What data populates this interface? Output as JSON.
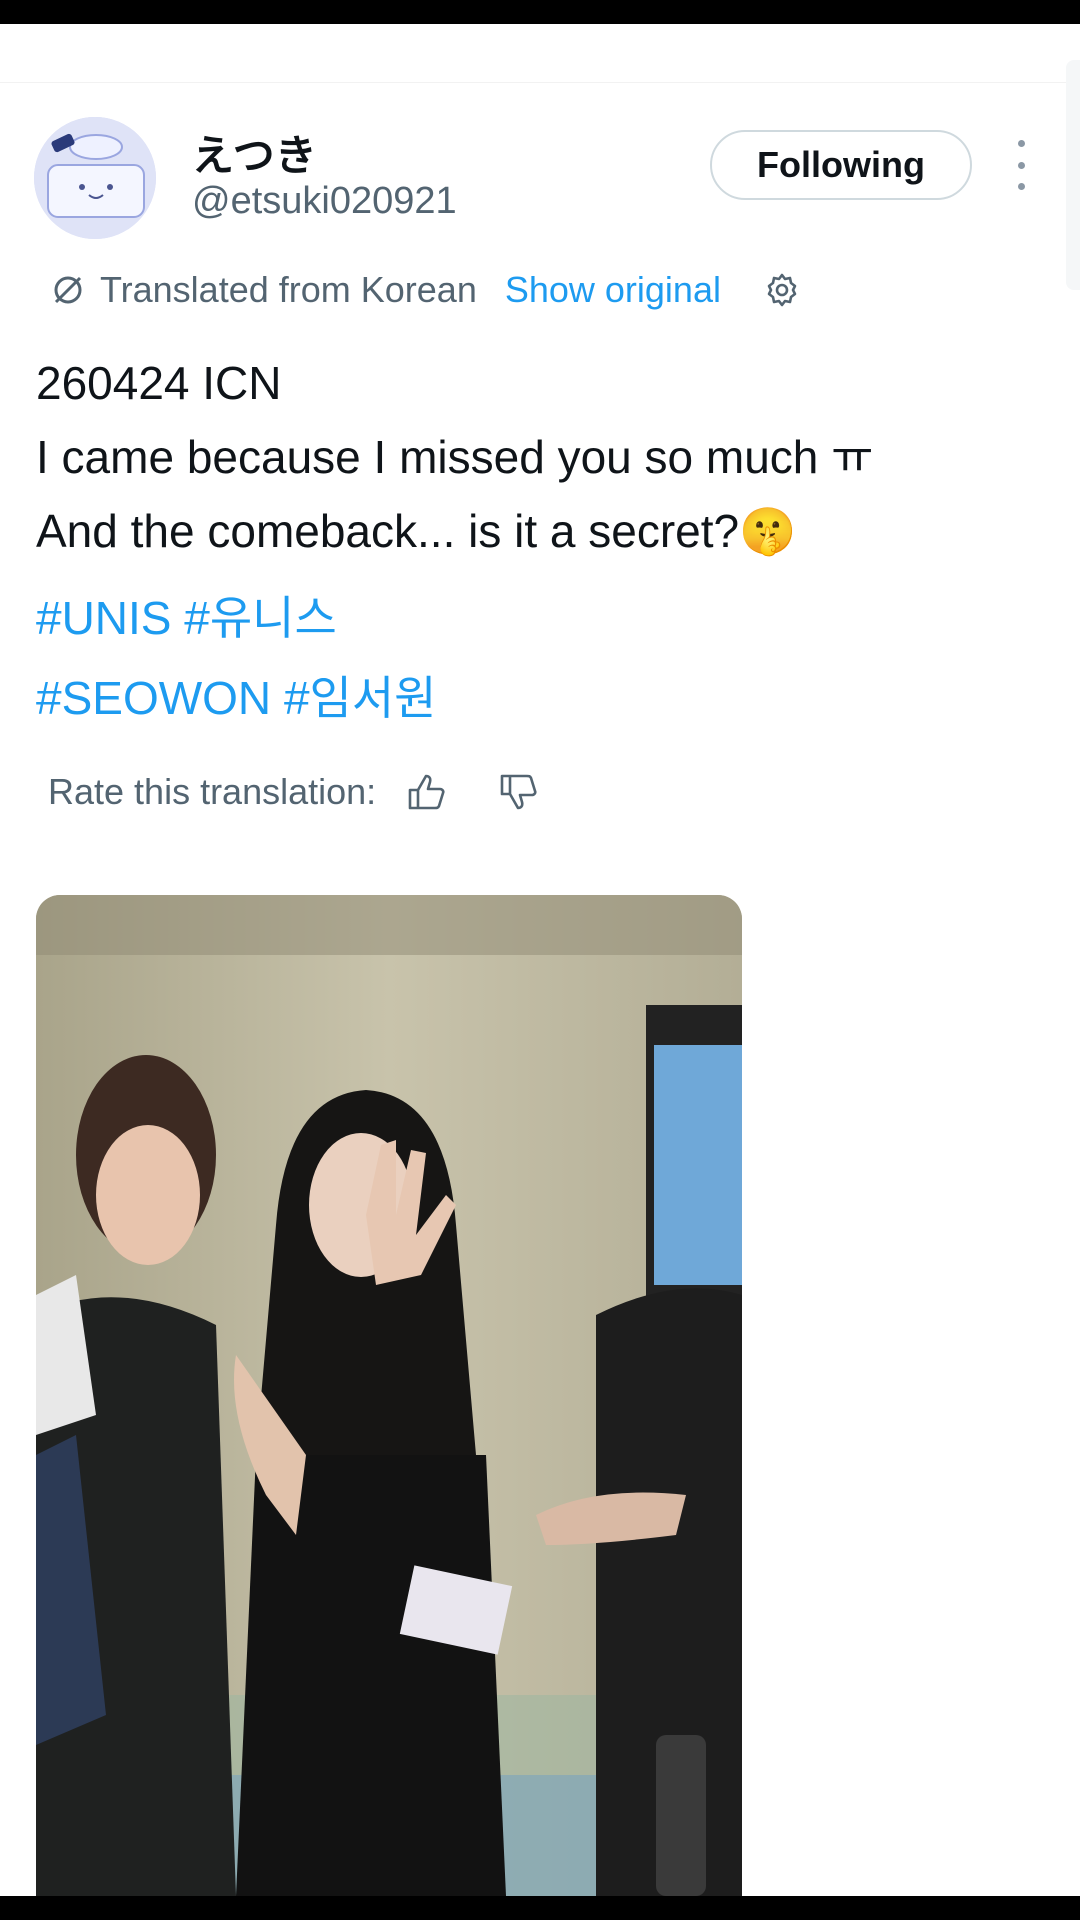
{
  "tweet": {
    "display_name": "えつき",
    "handle": "@etsuki020921",
    "follow_label": "Following",
    "translated_from": "Translated from Korean",
    "show_original": "Show original",
    "text_lines": [
      "260424 ICN",
      "I came because I missed you so much ㅠ",
      "And the comeback... is it a secret?🤫"
    ],
    "hashtag_lines": [
      [
        "#UNIS",
        "#유니스"
      ],
      [
        "#SEOWON",
        "#임서원"
      ]
    ],
    "rate_label": "Rate this translation:"
  },
  "icons": {
    "more": "more-vertical-icon",
    "translate": "translate-icon",
    "settings": "gear-icon",
    "like": "thumbs-up-icon",
    "dislike": "thumbs-down-icon"
  },
  "colors": {
    "link": "#1d9bf0",
    "secondary_text": "#536471",
    "primary_text": "#0f1419"
  }
}
